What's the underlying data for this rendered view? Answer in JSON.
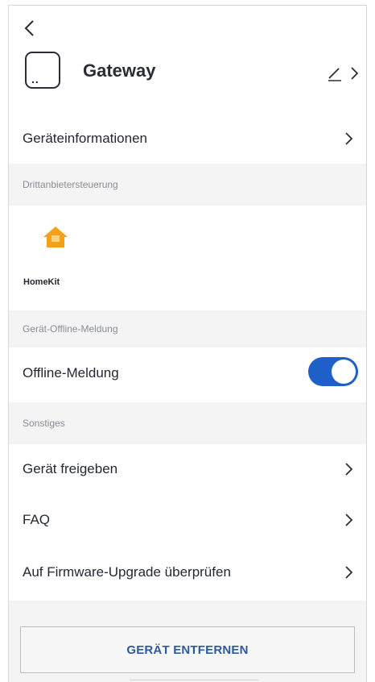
{
  "header": {
    "device_name": "Gateway",
    "icons": {
      "back": "back-chevron-icon",
      "device": "gateway-device-icon",
      "edit": "pencil-icon",
      "more": "chevron-right-icon"
    }
  },
  "info_row": {
    "label": "Geräteinformationen"
  },
  "third_party": {
    "section_title": "Drittanbietersteuerung",
    "homekit_label": "HomeKit"
  },
  "offline": {
    "section_title": "Gerät-Offline-Meldung",
    "label": "Offline-Meldung",
    "toggle_on": true
  },
  "other": {
    "section_title": "Sonstiges",
    "items": [
      {
        "label": "Gerät freigeben"
      },
      {
        "label": "FAQ"
      },
      {
        "label": "Auf Firmware-Upgrade überprüfen"
      }
    ]
  },
  "remove_button": {
    "label": "GERÄT ENTFERNEN"
  },
  "colors": {
    "accent": "#1f5fc8",
    "section_bg": "#f4f4f5",
    "homekit_orange": "#f5a01a",
    "button_text": "#2c5aa0"
  }
}
